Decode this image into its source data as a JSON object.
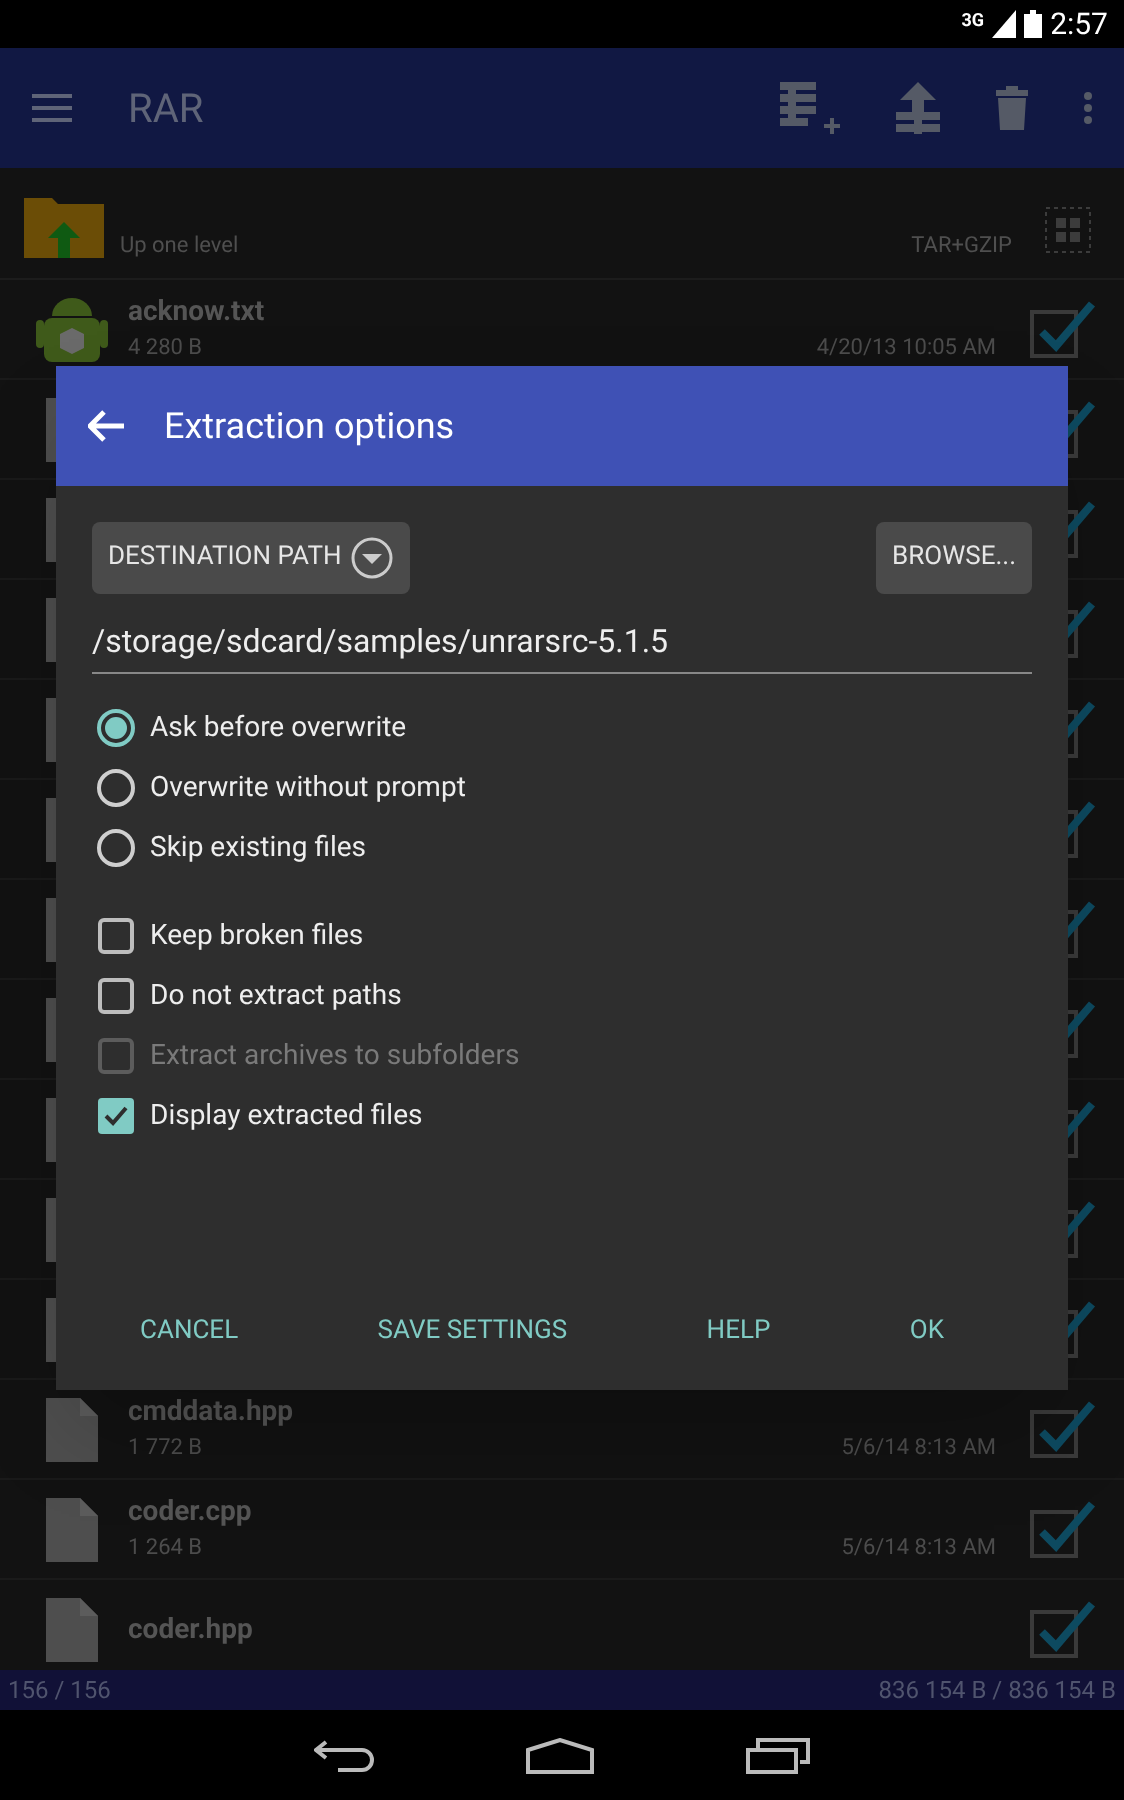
{
  "status_bar": {
    "network": "3G",
    "time": "2:57"
  },
  "app_bar": {
    "title": "RAR"
  },
  "up_row": {
    "label": "Up one level",
    "format": "TAR+GZIP"
  },
  "files": [
    {
      "kind": "android",
      "name": "acknow.txt",
      "size": "4 280 B",
      "date": "4/20/13 10:05 AM",
      "checked": true
    },
    {
      "kind": "file",
      "checked": true
    },
    {
      "kind": "file",
      "checked": true
    },
    {
      "kind": "file",
      "checked": true
    },
    {
      "kind": "file",
      "checked": true
    },
    {
      "kind": "file",
      "checked": true
    },
    {
      "kind": "file",
      "checked": true
    },
    {
      "kind": "file",
      "checked": true
    },
    {
      "kind": "file",
      "checked": true
    },
    {
      "kind": "file",
      "checked": true
    },
    {
      "kind": "file",
      "checked": true
    },
    {
      "kind": "file",
      "name": "cmddata.hpp",
      "size": "1 772 B",
      "date": "5/6/14 8:13 AM",
      "checked": true
    },
    {
      "kind": "file",
      "name": "coder.cpp",
      "size": "1 264 B",
      "date": "5/6/14 8:13 AM",
      "checked": true
    },
    {
      "kind": "file",
      "name": "coder.hpp",
      "checked": true
    }
  ],
  "footer": {
    "count": "156 / 156",
    "size": "836 154 B / 836 154 B"
  },
  "dialog": {
    "title": "Extraction options",
    "destination_button": "DESTINATION PATH",
    "browse_button": "BROWSE...",
    "path": "/storage/sdcard/samples/unrarsrc-5.1.5",
    "overwrite_options": [
      {
        "label": "Ask before overwrite",
        "selected": true
      },
      {
        "label": "Overwrite without prompt",
        "selected": false
      },
      {
        "label": "Skip existing files",
        "selected": false
      }
    ],
    "checkboxes": [
      {
        "label": "Keep broken files",
        "checked": false,
        "disabled": false
      },
      {
        "label": "Do not extract paths",
        "checked": false,
        "disabled": false
      },
      {
        "label": "Extract archives to subfolders",
        "checked": false,
        "disabled": true
      },
      {
        "label": "Display extracted files",
        "checked": true,
        "disabled": false
      }
    ],
    "actions": [
      "CANCEL",
      "SAVE SETTINGS",
      "HELP",
      "OK"
    ]
  }
}
